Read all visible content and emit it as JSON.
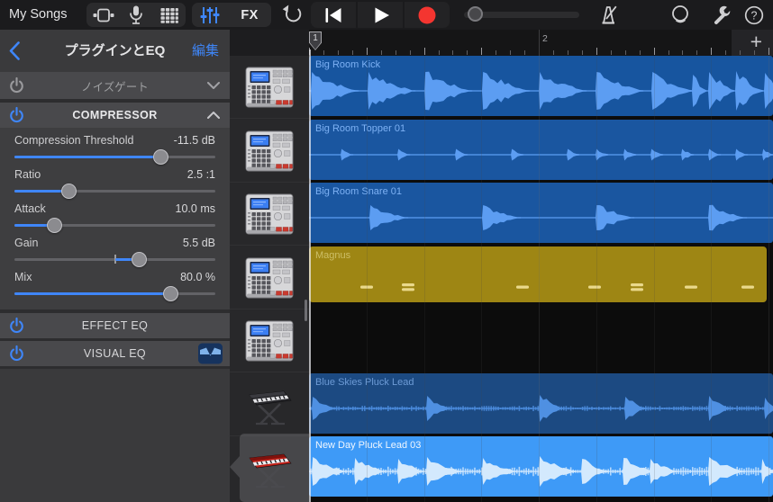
{
  "toolbar": {
    "my_songs_label": "My Songs",
    "fx_label": "FX",
    "accent_color": "#3f86f8",
    "record_color": "#f43530",
    "icons": [
      "tracks-view-icon",
      "microphone-icon",
      "live-loops-grid-icon",
      "mixer-controls-icon",
      "undo-icon",
      "skip-to-start-icon",
      "play-icon",
      "record-icon",
      "volume-slider",
      "metronome-icon",
      "loop-browser-icon",
      "settings-wrench-icon",
      "help-icon"
    ]
  },
  "plugin_panel": {
    "title": "プラグインとEQ",
    "edit_label": "編集",
    "plugin_rows": [
      {
        "name": "ノイズゲート",
        "enabled": false,
        "expanded": false
      },
      {
        "name": "COMPRESSOR",
        "enabled": true,
        "expanded": true
      }
    ],
    "compressor_params": [
      {
        "label": "Compression Threshold",
        "value": "-11.5 dB",
        "percent": 73,
        "bipolar": false
      },
      {
        "label": "Ratio",
        "value": "2.5 :1",
        "percent": 27,
        "bipolar": false
      },
      {
        "label": "Attack",
        "value": "10.0 ms",
        "percent": 20,
        "bipolar": false
      },
      {
        "label": "Gain",
        "value": "5.5 dB",
        "percent": 62,
        "bipolar": true
      },
      {
        "label": "Mix",
        "value": "80.0 %",
        "percent": 78,
        "bipolar": false
      }
    ],
    "eq_rows": [
      {
        "name": "EFFECT EQ",
        "enabled": true,
        "curve_icon": false
      },
      {
        "name": "VISUAL EQ",
        "enabled": true,
        "curve_icon": true
      }
    ]
  },
  "ruler": {
    "playhead_bar_label": "1",
    "bar2_label": "2",
    "add_button_label": "+"
  },
  "tracks": [
    {
      "name": "Big Room Kick",
      "instrument_icon": "drum-machine-icon",
      "region_type": "audio",
      "selected": false,
      "region_color": "#17559f",
      "wave_color": "#5c9df2",
      "label_color": "#7db1f4",
      "transients": [
        [
          2,
          52,
          21
        ],
        [
          65,
          52,
          21
        ],
        [
          128,
          52,
          21
        ],
        [
          192,
          52,
          21
        ],
        [
          255,
          52,
          21
        ],
        [
          318,
          52,
          21
        ],
        [
          380,
          45,
          21
        ],
        [
          425,
          15,
          18
        ],
        [
          443,
          28,
          21
        ],
        [
          473,
          30,
          22
        ],
        [
          505,
          18,
          20
        ]
      ]
    },
    {
      "name": "Big Room Topper 01",
      "instrument_icon": "drum-machine-icon",
      "region_type": "audio",
      "selected": false,
      "region_color": "#1a56a0",
      "wave_color": "#5c9df2",
      "label_color": "#7db1f4",
      "transients": [
        [
          35,
          13,
          6.5
        ],
        [
          98,
          13,
          6.5
        ],
        [
          162,
          13,
          6.5
        ],
        [
          224,
          13,
          6.5
        ],
        [
          286,
          13,
          6.5
        ],
        [
          318,
          13,
          6.5
        ],
        [
          349,
          13,
          6.5
        ],
        [
          379,
          13,
          6.5
        ],
        [
          413,
          13,
          6.5
        ],
        [
          443,
          13,
          6.5
        ],
        [
          473,
          13,
          6.5
        ],
        [
          503,
          11,
          6.5
        ]
      ]
    },
    {
      "name": "Big Room Snare 01",
      "instrument_icon": "drum-machine-icon",
      "region_type": "audio",
      "selected": false,
      "region_color": "#1a56a0",
      "wave_color": "#5c9df2",
      "label_color": "#7db1f4",
      "transients": [
        [
          67,
          42,
          14
        ],
        [
          192,
          42,
          14
        ],
        [
          318,
          42,
          14
        ],
        [
          443,
          42,
          14
        ]
      ]
    },
    {
      "name": "Magnus",
      "instrument_icon": "drum-machine-icon",
      "region_type": "midi",
      "selected": false,
      "region_color": "#9e8614",
      "wave_color": "#ead98c",
      "label_color": "#cdbf67",
      "notes": [
        [
          57,
          false
        ],
        [
          103,
          true
        ],
        [
          230,
          false
        ],
        [
          310,
          false
        ],
        [
          357,
          true
        ],
        [
          417,
          false
        ],
        [
          480,
          false
        ]
      ]
    },
    {
      "name": "",
      "instrument_icon": "drum-machine-icon",
      "region_type": "empty",
      "selected": false,
      "region_color": "",
      "wave_color": "",
      "label_color": ""
    },
    {
      "name": "Blue Skies Pluck Lead",
      "instrument_icon": "keyboard-dark-icon",
      "region_type": "audio",
      "selected": false,
      "region_color": "#1c4a82",
      "wave_color": "#4f90e2",
      "label_color": "#6d9bd6",
      "noise_amp": 2.4,
      "transients": [
        [
          3,
          26,
          13
        ],
        [
          130,
          26,
          14
        ],
        [
          255,
          26,
          15
        ],
        [
          350,
          24,
          13
        ],
        [
          443,
          26,
          14
        ],
        [
          505,
          12,
          12
        ]
      ]
    },
    {
      "name": "New Day Pluck Lead 03",
      "instrument_icon": "keyboard-red-icon",
      "region_type": "audio",
      "selected": true,
      "region_color": "#3e9af7",
      "wave_color": "#d3e9fd",
      "label_color": "#f0f7ff",
      "noise_amp": 4.2,
      "transients": [
        [
          3,
          38,
          16
        ],
        [
          50,
          34,
          15
        ],
        [
          98,
          30,
          14
        ],
        [
          130,
          40,
          16
        ],
        [
          192,
          38,
          15
        ],
        [
          255,
          40,
          17
        ],
        [
          302,
          30,
          14
        ],
        [
          348,
          34,
          15
        ],
        [
          378,
          30,
          14
        ],
        [
          443,
          40,
          16
        ],
        [
          502,
          13,
          14
        ]
      ]
    }
  ]
}
